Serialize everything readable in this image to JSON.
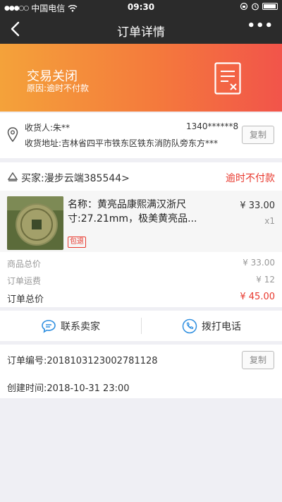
{
  "status_bar": {
    "carrier": "中国电信",
    "time": "09:30"
  },
  "nav": {
    "title": "订单详情",
    "more": "•••"
  },
  "banner": {
    "status": "交易关闭",
    "reason": "原因:逾时不付款"
  },
  "address": {
    "receiver": "收货人:朱**",
    "phone": "1340******8",
    "address": "收货地址:吉林省四平市铁东区铁东消防队旁东方***",
    "copy_label": "复制"
  },
  "order": {
    "seller": "买家:漫步云端385544>",
    "status": "逾时不付款",
    "item": {
      "name": "名称：黄亮品康熙满汉浙尺寸:27.21mm，极美黄亮品...",
      "price": "¥ 33.00",
      "qty": "x1",
      "badge": "包退"
    },
    "summary": [
      {
        "label": "商品总价",
        "value": "¥ 33.00"
      },
      {
        "label": "订单运费",
        "value": "¥ 12"
      },
      {
        "label": "订单总价",
        "value": "¥ 45.00"
      }
    ]
  },
  "actions": {
    "contact_seller": "联系卖家",
    "call": "拨打电话"
  },
  "info": {
    "order_no": "订单编号:2018103123002781128",
    "created": "创建时间:2018-10-31 23:00",
    "copy_label": "复制"
  },
  "colors": {
    "accent_red": "#e8382d",
    "action_blue": "#2f8fe0",
    "banner_start": "#f4a23a",
    "banner_end": "#f2544a"
  }
}
